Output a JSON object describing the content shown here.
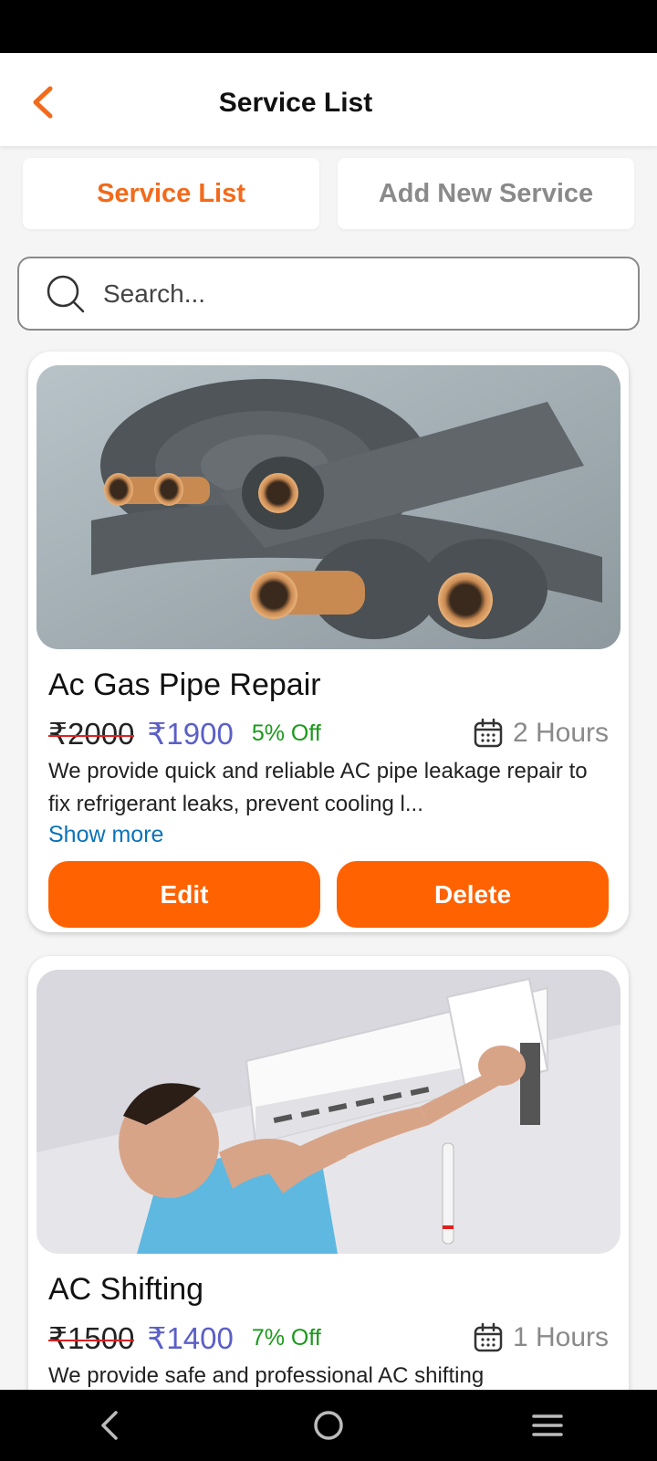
{
  "header": {
    "title": "Service List"
  },
  "tabs": [
    {
      "label": "Service List",
      "active": true
    },
    {
      "label": "Add New Service",
      "active": false
    }
  ],
  "search": {
    "placeholder": "Search..."
  },
  "services": [
    {
      "title": "Ac Gas Pipe Repair",
      "old_price": "₹2000",
      "new_price": "₹1900",
      "discount": "5% Off",
      "duration": "2 Hours",
      "description": "We provide quick and reliable AC pipe leakage repair to fix refrigerant leaks, prevent cooling l...",
      "show_more": "Show more",
      "edit_label": "Edit",
      "delete_label": "Delete"
    },
    {
      "title": "AC Shifting",
      "old_price": "₹1500",
      "new_price": "₹1400",
      "discount": "7% Off",
      "duration": "1 Hours",
      "description": "We provide safe and professional AC shifting"
    }
  ],
  "colors": {
    "accent": "#ff6200",
    "active_tab": "#f26a1b",
    "price": "#5b5fc7",
    "discount": "#1a9a1a",
    "link": "#0a72b8"
  },
  "icons": {
    "back": "chevron-left-icon",
    "search": "search-icon",
    "duration": "calendar-icon",
    "nav_back": "nav-back-icon",
    "nav_home": "nav-home-icon",
    "nav_menu": "nav-menu-icon"
  }
}
